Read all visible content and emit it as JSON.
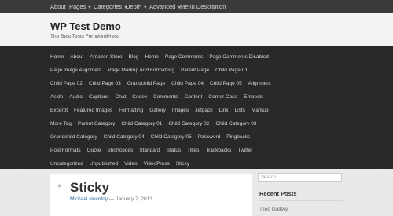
{
  "topbar": {
    "items": [
      {
        "label": "About",
        "dropdown": false
      },
      {
        "label": "Pages",
        "dropdown": true
      },
      {
        "label": "Categories",
        "dropdown": true
      },
      {
        "label": "Depth",
        "dropdown": true
      },
      {
        "label": "Advanced",
        "dropdown": true
      },
      {
        "label": "Menu Description",
        "dropdown": false
      }
    ]
  },
  "header": {
    "title": "WP Test Demo",
    "description": "The Best Tests For WordPress"
  },
  "nav": {
    "rows": [
      [
        "Home",
        "About",
        "Amazon Store",
        "Blog",
        "Home",
        "Page Comments",
        "Page Comments Disabled"
      ],
      [
        "Page Image Alignment",
        "Page Markup And Formatting",
        "Parent Page",
        "Child Page 01"
      ],
      [
        "Child Page 02",
        "Child Page 03",
        "Grandchild Page",
        "Child Page 04",
        "Child Page 05",
        "Alignment"
      ],
      [
        "Aside",
        "Audio",
        "Captions",
        "Chat",
        "Codex",
        "Comments",
        "Content",
        "Corner Case",
        "Embeds"
      ],
      [
        "Excerpt",
        "Featured Images",
        "Formatting",
        "Gallery",
        "Images",
        "Jetpack",
        "Link",
        "Lists",
        "Markup"
      ],
      [
        "More Tag",
        "Parent Category",
        "Child Category 01",
        "Child Category 02",
        "Child Category 03"
      ],
      [
        "Grandchild Category",
        "Child Category 04",
        "Child Category 05",
        "Password",
        "Pingbacks"
      ],
      [
        "Post Formats",
        "Quote",
        "Shortcodes",
        "Standard",
        "Status",
        "Titles",
        "Trackbacks",
        "Twitter"
      ],
      [
        "Uncategorized",
        "Unpublished",
        "Video",
        "VideoPress",
        "Sticky"
      ]
    ]
  },
  "post": {
    "title": "Sticky",
    "author": "Michael Novotny",
    "separator": "—",
    "date": "January 7, 2013"
  },
  "sidebar": {
    "search_placeholder": "Search...",
    "widget_title": "Recent Posts",
    "recent_posts": [
      "Tiled Gallery"
    ]
  },
  "icons": {
    "caret": "caret-down-icon",
    "sticky": "star-icon"
  }
}
